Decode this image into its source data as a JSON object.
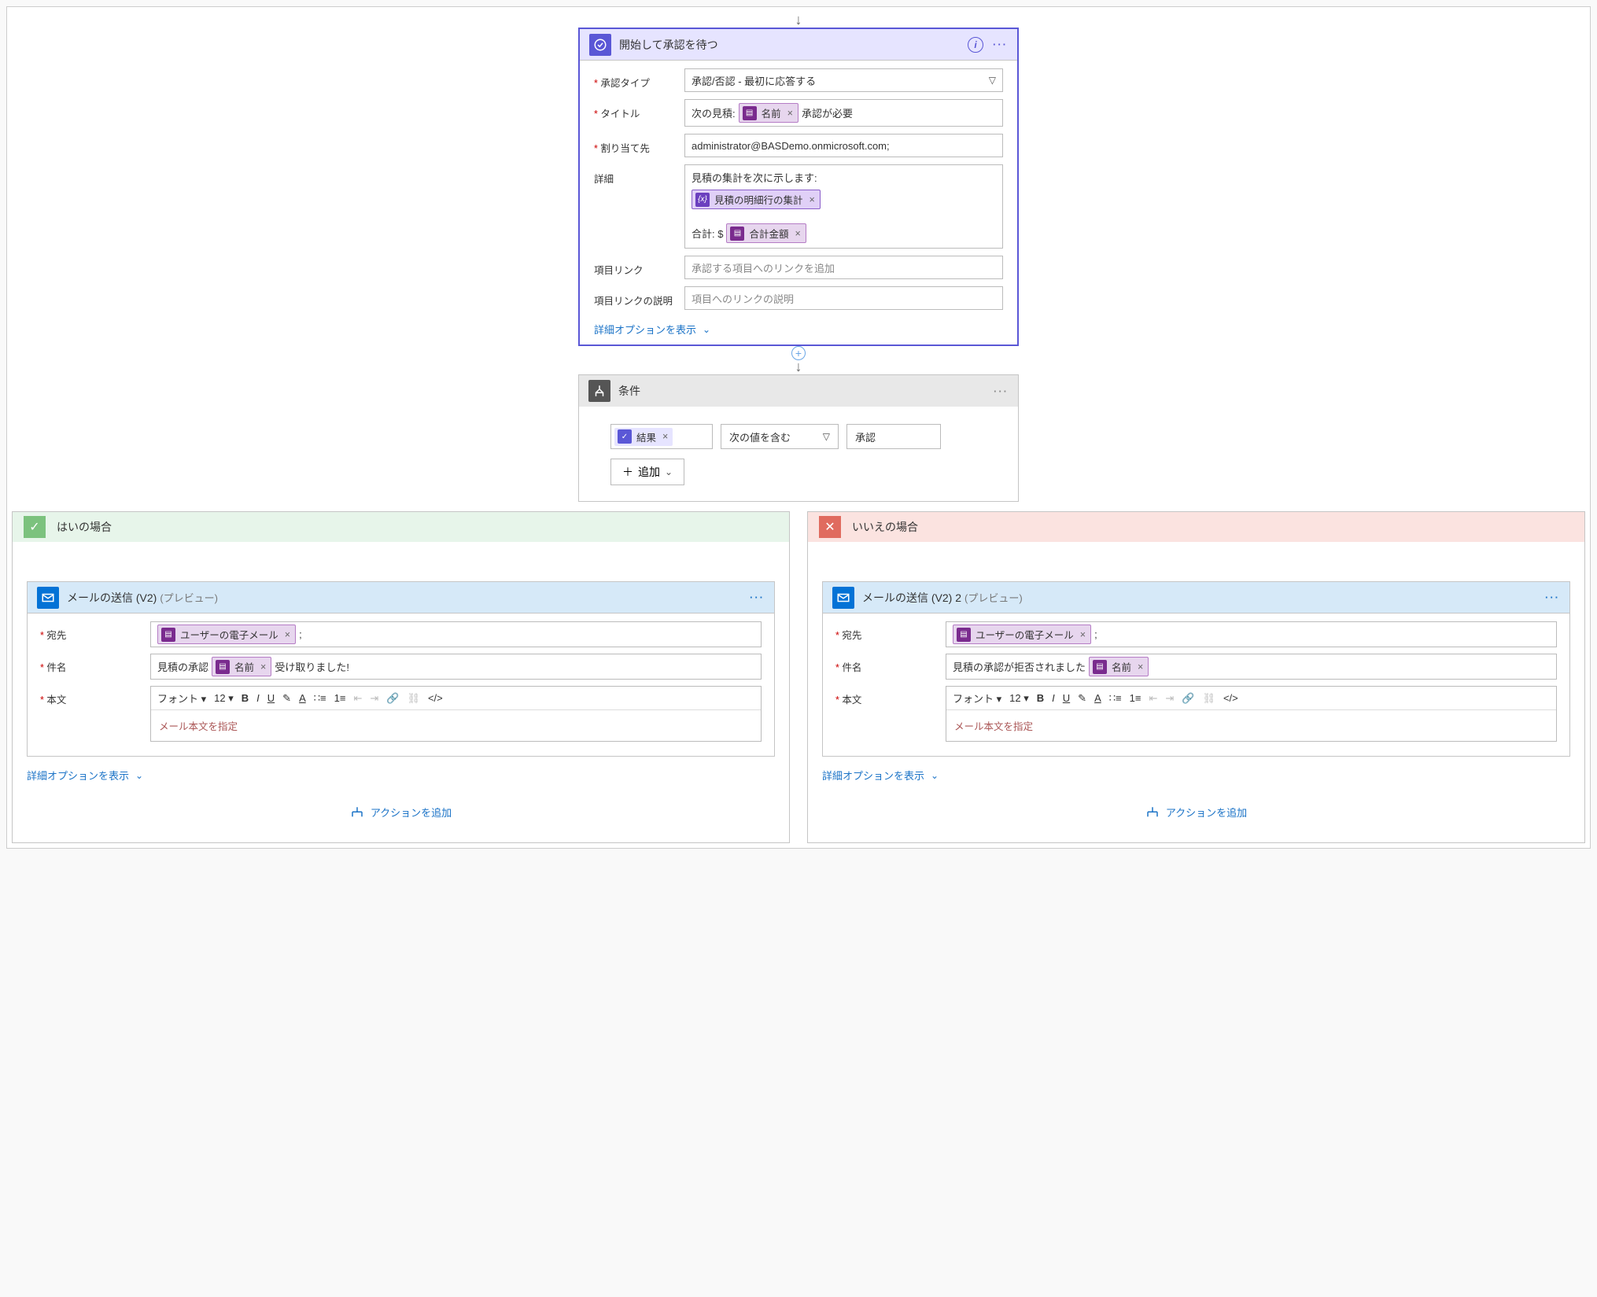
{
  "approval": {
    "title": "開始して承認を待つ",
    "fields": {
      "type_label": "承認タイプ",
      "type_value": "承認/否認 - 最初に応答する",
      "title_label": "タイトル",
      "title_prefix": "次の見積:",
      "title_token": "名前",
      "title_suffix": "承認が必要",
      "assign_label": "割り当て先",
      "assign_value": "administrator@BASDemo.onmicrosoft.com;",
      "detail_label": "詳細",
      "detail_line1": "見積の集計を次に示します:",
      "detail_token1": "見積の明細行の集計",
      "detail_line2_prefix": "合計: $",
      "detail_token2": "合計金額",
      "link_label": "項目リンク",
      "link_ph": "承認する項目へのリンクを追加",
      "linkdesc_label": "項目リンクの説明",
      "linkdesc_ph": "項目へのリンクの説明"
    },
    "show_options": "詳細オプションを表示"
  },
  "condition": {
    "title": "条件",
    "token": "結果",
    "operator": "次の値を含む",
    "value": "承認",
    "add": "追加"
  },
  "yes_branch": {
    "title": "はいの場合",
    "email": {
      "title": "メールの送信 (V2)",
      "preview": "(プレビュー)",
      "to_label": "宛先",
      "to_token": "ユーザーの電子メール",
      "to_suffix": ";",
      "subject_label": "件名",
      "subject_prefix": "見積の承認",
      "subject_token": "名前",
      "subject_suffix": "受け取りました!",
      "body_label": "本文",
      "font": "フォント",
      "size": "12",
      "body_ph": "メール本文を指定"
    },
    "show_options": "詳細オプションを表示",
    "add_action": "アクションを追加"
  },
  "no_branch": {
    "title": "いいえの場合",
    "email": {
      "title": "メールの送信 (V2) 2",
      "preview": "(プレビュー)",
      "to_label": "宛先",
      "to_token": "ユーザーの電子メール",
      "to_suffix": ";",
      "subject_label": "件名",
      "subject_prefix": "見積の承認が拒否されました",
      "subject_token": "名前",
      "body_label": "本文",
      "font": "フォント",
      "size": "12",
      "body_ph": "メール本文を指定"
    },
    "show_options": "詳細オプションを表示",
    "add_action": "アクションを追加"
  }
}
